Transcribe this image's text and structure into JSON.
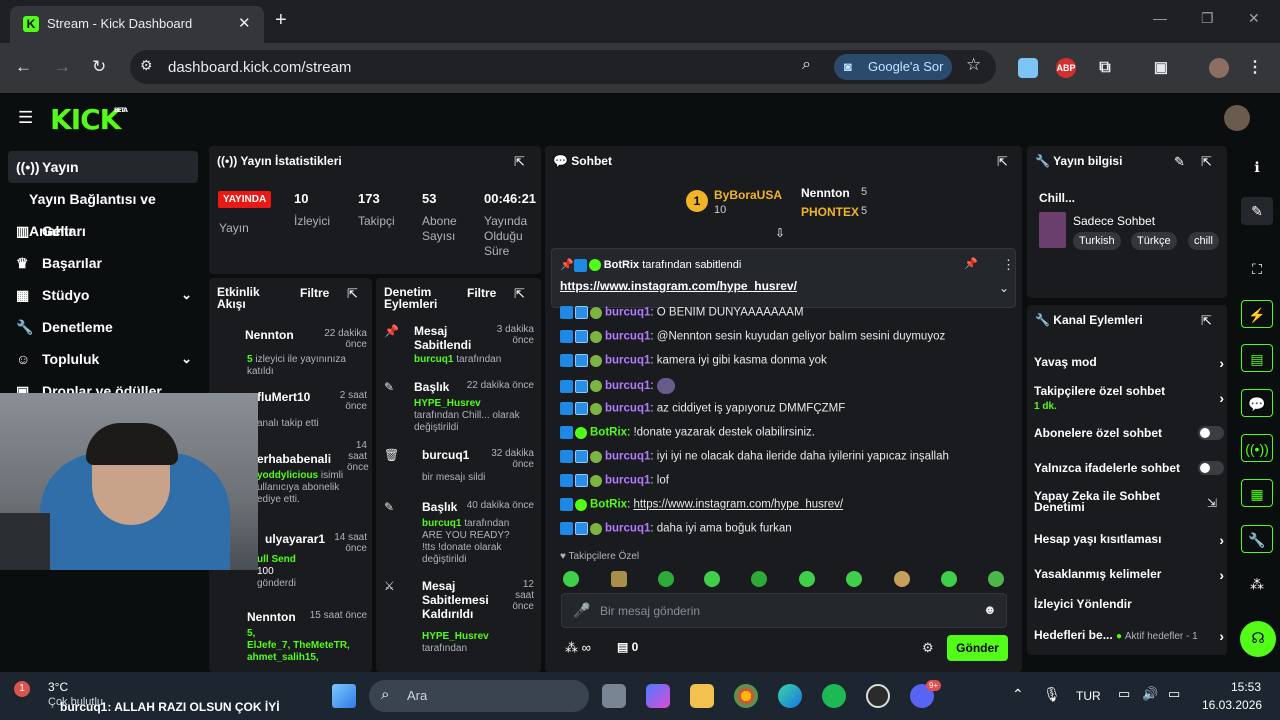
{
  "browser": {
    "tab_title": "Stream - Kick Dashboard",
    "url": "dashboard.kick.com/stream",
    "google_sor": "Google'a Sor",
    "abp": "ABP"
  },
  "kick": {
    "logo": "KICK",
    "beta": "BETA"
  },
  "sidebar": {
    "items": [
      {
        "label": "Yayın"
      },
      {
        "label": "Yayın Bağlantısı ve Anahtarı"
      },
      {
        "label": "Gelir"
      },
      {
        "label": "Başarılar"
      },
      {
        "label": "Stüdyo"
      },
      {
        "label": "Denetleme"
      },
      {
        "label": "Topluluk"
      },
      {
        "label": "Droplar ve ödüller"
      }
    ]
  },
  "stats": {
    "title": "Yayın İstatistikleri",
    "live": "YAYINDA",
    "status_label": "Yayın",
    "viewers": "10",
    "viewers_label": "İzleyici",
    "followers": "173",
    "followers_label": "Takipçi",
    "subs": "53",
    "subs_label": "Abone Sayısı",
    "duration": "00:46:21",
    "duration_label": "Yayında Olduğu Süre"
  },
  "activity": {
    "title": "Etkinlik Akışı",
    "filter": "Filtre",
    "items": [
      {
        "name": "Nennton",
        "time": "22 dakika önce",
        "count": "5",
        "desc": "izleyici ile yayınınıza katıldı"
      },
      {
        "name": "fluMert10",
        "time": "2 saat önce",
        "desc": "analı takip etti"
      },
      {
        "name": "erhababenali",
        "time": "14 saat önce",
        "user": "yoddylicious",
        "desc": "isimli ullanıcıya abonelik ediye etti."
      },
      {
        "name": "ulyayarar1",
        "time": "14 saat önce",
        "line1": "ull Send",
        "count": "100",
        "desc": "gönderdi"
      },
      {
        "name": "Nennton",
        "time": "15 saat önce",
        "count": "5,",
        "users": "ElJefe_7, TheMeteTR, ahmet_salih15,"
      }
    ]
  },
  "moderation": {
    "title": "Denetim Eylemleri",
    "filter": "Filtre",
    "items": [
      {
        "title": "Mesaj Sabitlendi",
        "time": "3 dakika önce",
        "user": "burcuq1",
        "desc": "tarafından"
      },
      {
        "title": "Başlık",
        "time": "22 dakika önce",
        "user": "HYPE_Husrev",
        "desc": "tarafından Chill... olarak değiştirildi"
      },
      {
        "title": "burcuq1",
        "time": "32 dakika önce",
        "desc": "bir mesajı sildi"
      },
      {
        "title": "Başlık",
        "time": "40 dakika önce",
        "user": "burcuq1",
        "desc": "tarafından ARE YOU READY? !tts !donate olarak değiştirildi"
      },
      {
        "title": "Mesaj Sabitlemesi Kaldırıldı",
        "time": "12 saat önce",
        "user": "HYPE_Husrev",
        "desc": "tarafından"
      }
    ]
  },
  "chat": {
    "title": "Sohbet",
    "top1": "ByBoraUSA",
    "top1_count": "10",
    "top1_rank": "1",
    "top2": "Nennton",
    "top2_count": "5",
    "top3": "PHONTEX",
    "top3_count": "5",
    "pinned_by": "BotRix",
    "pinned_suffix": "tarafından sabitlendi",
    "pinned_link": "https://www.instagram.com/hype_husrev/",
    "messages": [
      {
        "user": "burcuq1",
        "text": "O BENIM DUNYAAAAAAAM"
      },
      {
        "user": "burcuq1",
        "text": "@Nennton sesin kuyudan geliyor balım sesini duymuyoz"
      },
      {
        "user": "burcuq1",
        "text": "kamera iyi gibi kasma donma yok"
      },
      {
        "user": "burcuq1",
        "text": ""
      },
      {
        "user": "burcuq1",
        "text": "az ciddiyet iş yapıyoruz DMMFÇZMF"
      },
      {
        "user": "BotRix",
        "text": "!donate yazarak destek olabilirsiniz."
      },
      {
        "user": "burcuq1",
        "text": "iyi iyi ne olacak daha ileride daha iyilerini yapıcaz inşallah"
      },
      {
        "user": "burcuq1",
        "text": "lof"
      },
      {
        "user": "BotRix",
        "text": "https://www.instagram.com/hype_husrev/"
      },
      {
        "user": "burcuq1",
        "text": "daha iyi ama boğuk furkan"
      }
    ],
    "followers_only": "Takipçilere Özel",
    "placeholder": "Bir mesaj gönderin",
    "infinity": "∞",
    "count": "0",
    "send": "Gönder"
  },
  "info": {
    "title": "Yayın bilgisi",
    "stream_title": "Chill...",
    "category": "Sadece Sohbet",
    "tags": [
      "Turkish",
      "Türkçe",
      "chill"
    ]
  },
  "channel": {
    "title": "Kanal Eylemleri",
    "actions": [
      {
        "label": "Yavaş mod"
      },
      {
        "label": "Takipçilere özel sohbet",
        "sub": "1 dk."
      },
      {
        "label": "Abonelere özel sohbet"
      },
      {
        "label": "Yalnızca ifadelerle sohbet"
      },
      {
        "label": "Yapay Zeka ile Sohbet Denetimi"
      },
      {
        "label": "Hesap yaşı kısıtlaması"
      },
      {
        "label": "Yasaklanmış kelimeler"
      },
      {
        "label": "İzleyici Yönlendir"
      },
      {
        "label": "Hedefleri be...",
        "sub": "Aktif hedefler - 1"
      }
    ]
  },
  "overlay_text": "burcuq1: ALLAH RAZI OLSUN ÇOK İYİ",
  "taskbar": {
    "temp": "3°C",
    "weather": "Çok bulutlu",
    "weather_badge": "1",
    "search": "Ara",
    "lang": "TUR",
    "time": "15:53",
    "date": "16.03.2026",
    "discord_badge": "9+"
  }
}
